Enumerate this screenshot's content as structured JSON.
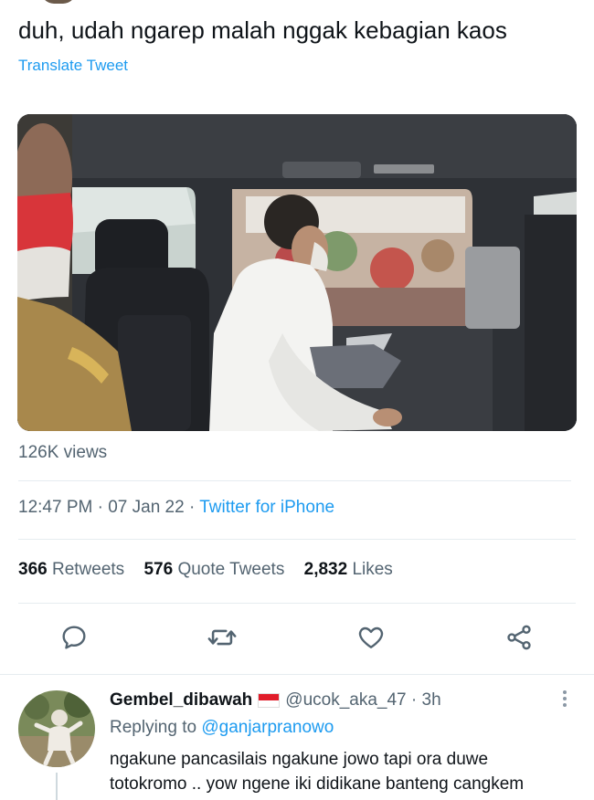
{
  "tweet": {
    "text": "duh, udah ngarep malah nggak kebagian kaos",
    "translate_label": "Translate Tweet",
    "views": "126K views",
    "time": "12:47 PM",
    "date": "07 Jan 22",
    "source": "Twitter for iPhone",
    "separator": "·"
  },
  "stats": {
    "retweets_count": "366",
    "retweets_label": "Retweets",
    "quotes_count": "576",
    "quotes_label": "Quote Tweets",
    "likes_count": "2,832",
    "likes_label": "Likes"
  },
  "actions": {
    "icons": [
      "reply-icon",
      "retweet-icon",
      "like-icon",
      "share-icon"
    ],
    "icon_color": "#536471"
  },
  "reply": {
    "display_name": "Gembel_dibawah",
    "handle": "@ucok_aka_47",
    "separator": "·",
    "age": "3h",
    "replying_prefix": "Replying to",
    "replying_to": "@ganjarpranowo",
    "body_line1": "ngakune pancasilais ngakune jowo tapi ora duwe",
    "body_line2": "totokromo .. yow ngene iki didikane banteng cangkem"
  },
  "colors": {
    "accent": "#1d9bf0",
    "secondary_text": "#536471",
    "primary_text": "#0f1419",
    "divider": "#e6ecf0"
  }
}
